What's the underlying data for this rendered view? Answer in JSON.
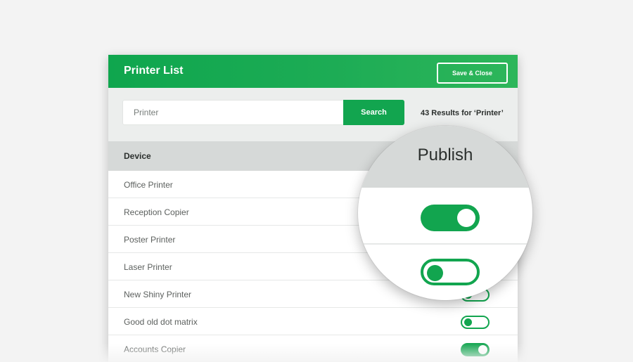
{
  "header": {
    "title": "Printer List",
    "save_label": "Save & Close"
  },
  "search": {
    "value": "Printer",
    "button_label": "Search",
    "results_text": "43 Results for ‘Printer’"
  },
  "table": {
    "column_device": "Device",
    "column_publish": "Publish",
    "rows": [
      {
        "name": "Office Printer",
        "published": true
      },
      {
        "name": "Reception Copier",
        "published": false
      },
      {
        "name": "Poster Printer",
        "published": true
      },
      {
        "name": "Laser Printer",
        "published": true
      },
      {
        "name": "New Shiny Printer",
        "published": false
      },
      {
        "name": "Good old dot matrix",
        "published": false
      },
      {
        "name": "Accounts Copier",
        "published": true
      }
    ]
  },
  "colors": {
    "accent": "#12a54f",
    "header_gradient_end": "#2db65a",
    "table_header_bg": "#d6d9d8",
    "search_bar_bg": "#eceeed"
  }
}
